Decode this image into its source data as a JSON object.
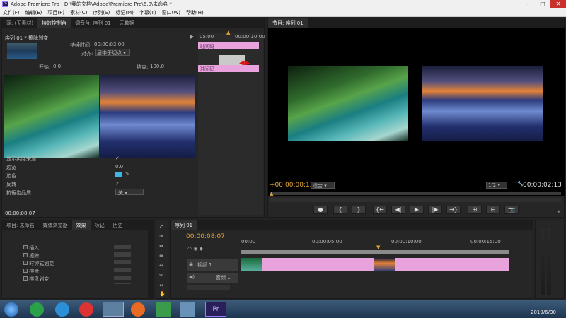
{
  "app": {
    "title": "Adobe Premiere Pro - D:\\我的文档\\Adobe\\Premiere Pro\\6.0\\未命名 *",
    "menu": [
      "文件(F)",
      "编辑(E)",
      "项目(P)",
      "素材(C)",
      "序列(S)",
      "标记(M)",
      "字幕(T)",
      "窗口(W)",
      "帮助(H)"
    ]
  },
  "source_panel": {
    "tabs": [
      "源: (无素材)",
      "特效控制台",
      "调音台: 序列 01",
      "元数据"
    ],
    "header": "序列 01 * 擦除划变",
    "duration_label": "持续时间",
    "duration": "00:00:02:00",
    "align_label": "对齐:",
    "align_value": "居中于切点",
    "start_label": "开始:",
    "start_value": "0.0",
    "end_label": "结束:",
    "end_value": "100.0",
    "mini_timeline": {
      "time_start": "05:00",
      "time_end": "00:00:10:00",
      "clip_a": "时间码",
      "clip_b": "时间码",
      "marker": "▲"
    },
    "properties": [
      {
        "label": "显示实际来源",
        "value": "✓"
      },
      {
        "label": "边宽",
        "value": "0.0"
      },
      {
        "label": "边色",
        "value": ""
      },
      {
        "label": "反转",
        "value": "✓"
      },
      {
        "label": "抗锯齿品质",
        "value": "关"
      }
    ],
    "footer_time": "00:00:08:07"
  },
  "program_panel": {
    "tab": "节目: 序列 01",
    "current_time": "+00:00:00:13",
    "fit": "适合",
    "fraction": "1/2",
    "total_time": "00:00:02:13",
    "transport_buttons": [
      "●",
      "{",
      "}",
      "{←",
      "◀|",
      "▶",
      "|▶",
      "→}",
      "⊞",
      "⊟",
      "📷"
    ]
  },
  "project_panel": {
    "tabs": [
      "项目: 未命名",
      "媒体浏览器",
      "效果",
      "标记",
      "历史"
    ],
    "items": [
      "插入",
      "擦除",
      "时钟式划变",
      "棋盘",
      "棋盘划变"
    ]
  },
  "timeline_panel": {
    "tab": "序列 01",
    "current_time": "00:00:08:07",
    "ruler": [
      "00:00",
      "00:00:05:00",
      "00:00:10:00",
      "00:00:15:00"
    ],
    "video_track": "视频 1",
    "audio_track": "音频 1"
  },
  "taskbar": {
    "date": "2019/6/30"
  },
  "colors": {
    "accent_orange": "#e3a33b",
    "clip_pink": "#e8a3dd",
    "accent_blue": "#3e8ee0"
  }
}
